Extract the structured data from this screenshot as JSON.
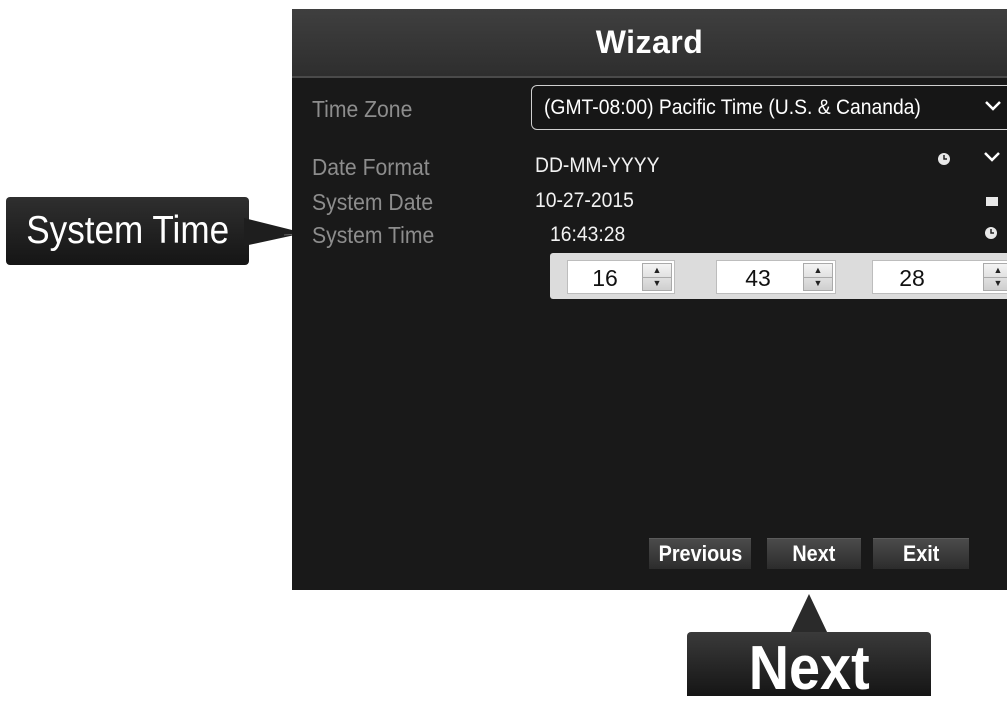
{
  "dialog": {
    "title": "Wizard",
    "time_zone": {
      "label": "Time Zone",
      "value": "(GMT-08:00) Pacific Time (U.S. & Cananda)"
    },
    "date_format": {
      "label": "Date Format",
      "value": "DD-MM-YYYY"
    },
    "system_date": {
      "label": "System Date",
      "value": "10-27-2015"
    },
    "system_time": {
      "label": "System Time",
      "value": "16:43:28",
      "hours": "16",
      "minutes": "43",
      "seconds": "28"
    },
    "buttons": {
      "previous": "Previous",
      "next": "Next",
      "exit": "Exit"
    }
  },
  "callouts": {
    "system_time": "System Time",
    "next": "Next"
  },
  "icons": {
    "dropdown": "chevron-down-icon",
    "clock": "clock-icon",
    "calendar": "calendar-icon"
  },
  "colors": {
    "dialog_bg": "#191919",
    "titlebar": "#383838",
    "label_text": "#8d8d8d",
    "value_text": "#f2f2f2",
    "callout_bg": "#1e1e1e"
  }
}
